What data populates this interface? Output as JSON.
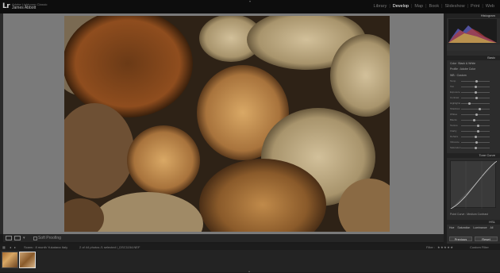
{
  "app": {
    "logo": "Lr",
    "identity_line1": "Adobe Lightroom Classic",
    "identity_line2": "James Abbott"
  },
  "modules": [
    "Library",
    "Develop",
    "Map",
    "Book",
    "Slideshow",
    "Print",
    "Web"
  ],
  "active_module": "Develop",
  "toolbar": {
    "soft_proofing": "Soft Proofing"
  },
  "right_panel": {
    "histogram_label": "Histogram",
    "basic_label": "Basic",
    "treatment": [
      "Color",
      "Black & White"
    ],
    "profile": {
      "label": "Profile :",
      "value": "Adobe Color"
    },
    "wb": {
      "label": "WB :",
      "value": "Custom"
    },
    "sliders": [
      {
        "label": "Temp",
        "level": 0.55
      },
      {
        "label": "Tint",
        "level": 0.5
      },
      {
        "label": "Exposure",
        "level": 0.52
      },
      {
        "label": "Contrast",
        "level": 0.55
      },
      {
        "label": "Highlights",
        "level": 0.3
      },
      {
        "label": "Shadows",
        "level": 0.65
      },
      {
        "label": "Whites",
        "level": 0.55
      },
      {
        "label": "Blacks",
        "level": 0.45
      },
      {
        "label": "Texture",
        "level": 0.6
      },
      {
        "label": "Clarity",
        "level": 0.6
      },
      {
        "label": "Dehaze",
        "level": 0.5
      },
      {
        "label": "Vibrance",
        "level": 0.55
      },
      {
        "label": "Saturation",
        "level": 0.5
      }
    ],
    "tone_curve_label": "Tone Curve",
    "point_curve": {
      "label": "Point Curve :",
      "value": "Medium Contrast"
    },
    "hsl_label": "HSL",
    "hsl_tabs": [
      "Hue",
      "Saturation",
      "Luminance",
      "All"
    ],
    "previous_button": "Previous",
    "reset_button": "Reset"
  },
  "filmstrip": {
    "source": "Scans : 8 month Yukatana Italy",
    "count": "2 of 44 photos /1 selected /_DSC1154.NEF",
    "filter_label": "Filter :",
    "filter_value": "Custom Filter"
  },
  "colors": {
    "active_module": "#ffffff",
    "inactive_module": "#777777",
    "canvas_gray": "#7a7a7a"
  }
}
